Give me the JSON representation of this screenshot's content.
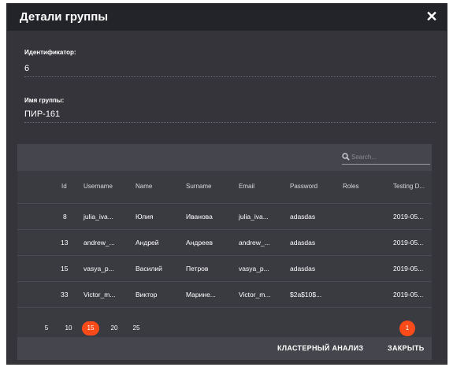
{
  "dialog": {
    "title": "Детали группы",
    "close_glyph": "✕"
  },
  "fields": {
    "id_label": "Идентификатор:",
    "id_value": "6",
    "name_label": "Имя группы:",
    "name_value": "ПИР-161"
  },
  "search": {
    "placeholder": "Search..."
  },
  "table": {
    "columns": [
      "Id",
      "Username",
      "Name",
      "Surname",
      "Email",
      "Password",
      "Roles",
      "Testing D..."
    ],
    "rows": [
      {
        "id": "8",
        "username": "julia_iva...",
        "name": "Юлия",
        "surname": "Иванова",
        "email": "julia_iva...",
        "password": "adasdas",
        "roles": "",
        "testing": "2019-05..."
      },
      {
        "id": "13",
        "username": "andrew_...",
        "name": "Андрей",
        "surname": "Андреев",
        "email": "andrew_...",
        "password": "adasdas",
        "roles": "",
        "testing": "2019-05..."
      },
      {
        "id": "15",
        "username": "vasya_p...",
        "name": "Василий",
        "surname": "Петров",
        "email": "vasya_p...",
        "password": "adasdas",
        "roles": "",
        "testing": "2019-05..."
      },
      {
        "id": "33",
        "username": "Victor_m...",
        "name": "Виктор",
        "surname": "Марине...",
        "email": "Victor_m...",
        "password": "$2a$10$...",
        "roles": "",
        "testing": "2019-05..."
      }
    ]
  },
  "pagination": {
    "sizes": [
      "5",
      "10",
      "15",
      "20",
      "25"
    ],
    "selected_size": "15",
    "current_page": "1"
  },
  "footer": {
    "cluster_button": "КЛАСТЕРНЫЙ АНАЛИЗ",
    "close_button": "ЗАКРЫТЬ"
  },
  "colors": {
    "accent": "#ff4a1a",
    "dialog_bg": "#34343a",
    "titlebar_bg": "#23232a"
  }
}
